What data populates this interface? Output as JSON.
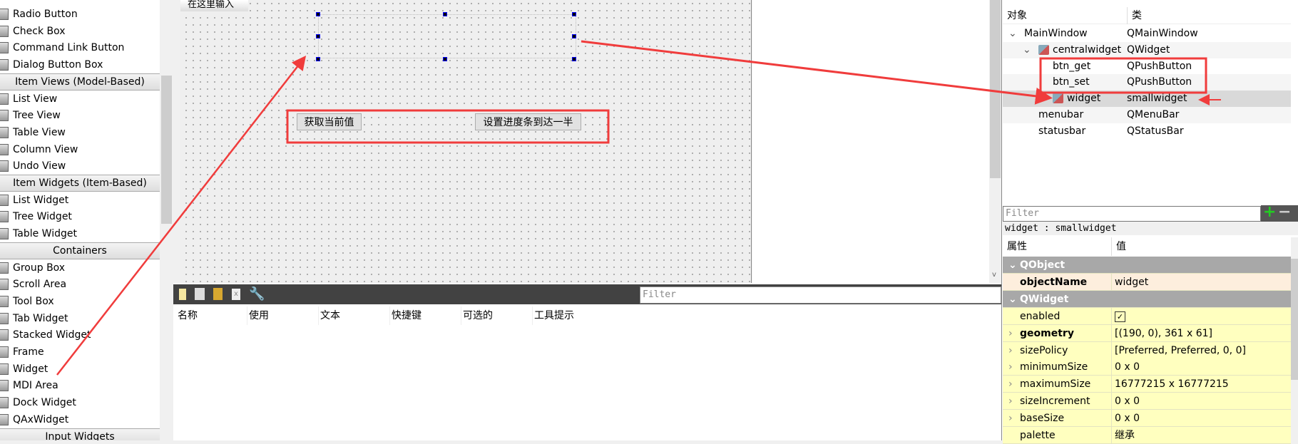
{
  "widget_box": {
    "items": [
      {
        "label": "Radio Button",
        "cat": false
      },
      {
        "label": "Check Box",
        "cat": false
      },
      {
        "label": "Command Link Button",
        "cat": false
      },
      {
        "label": "Dialog Button Box",
        "cat": false
      },
      {
        "label": "Item Views (Model-Based)",
        "cat": true
      },
      {
        "label": "List View",
        "cat": false
      },
      {
        "label": "Tree View",
        "cat": false
      },
      {
        "label": "Table View",
        "cat": false
      },
      {
        "label": "Column View",
        "cat": false
      },
      {
        "label": "Undo View",
        "cat": false
      },
      {
        "label": "Item Widgets (Item-Based)",
        "cat": true
      },
      {
        "label": "List Widget",
        "cat": false
      },
      {
        "label": "Tree Widget",
        "cat": false
      },
      {
        "label": "Table Widget",
        "cat": false
      },
      {
        "label": "Containers",
        "cat": true
      },
      {
        "label": "Group Box",
        "cat": false
      },
      {
        "label": "Scroll Area",
        "cat": false
      },
      {
        "label": "Tool Box",
        "cat": false
      },
      {
        "label": "Tab Widget",
        "cat": false
      },
      {
        "label": "Stacked Widget",
        "cat": false
      },
      {
        "label": "Frame",
        "cat": false
      },
      {
        "label": "Widget",
        "cat": false
      },
      {
        "label": "MDI Area",
        "cat": false
      },
      {
        "label": "Dock Widget",
        "cat": false
      },
      {
        "label": "QAxWidget",
        "cat": false
      },
      {
        "label": "Input Widgets",
        "cat": true
      }
    ]
  },
  "form": {
    "menu_placeholder": "在这里输入",
    "btn_get": "获取当前值",
    "btn_set": "设置进度条到达一半"
  },
  "action_editor": {
    "filter_placeholder": "Filter",
    "columns": [
      "名称",
      "使用",
      "文本",
      "快捷键",
      "可选的",
      "工具提示"
    ]
  },
  "object_inspector": {
    "headers": [
      "对象",
      "类"
    ],
    "rows": [
      {
        "name": "MainWindow",
        "cls": "QMainWindow",
        "indent": 0,
        "expand": true
      },
      {
        "name": "centralwidget",
        "cls": "QWidget",
        "indent": 1,
        "expand": true,
        "icon": true
      },
      {
        "name": "btn_get",
        "cls": "QPushButton",
        "indent": 2
      },
      {
        "name": "btn_set",
        "cls": "QPushButton",
        "indent": 2
      },
      {
        "name": "widget",
        "cls": "smallwidget",
        "indent": 2,
        "icon": true,
        "selected": true
      },
      {
        "name": "menubar",
        "cls": "QMenuBar",
        "indent": 1
      },
      {
        "name": "statusbar",
        "cls": "QStatusBar",
        "indent": 1
      }
    ]
  },
  "property_editor": {
    "filter_placeholder": "Filter",
    "current": "widget : smallwidget",
    "headers": [
      "属性",
      "值"
    ],
    "rows": [
      {
        "group": "QObject"
      },
      {
        "name": "objectName",
        "value": "widget",
        "bold": true,
        "orange": true
      },
      {
        "group": "QWidget"
      },
      {
        "name": "enabled",
        "value": "",
        "checkbox": true
      },
      {
        "name": "geometry",
        "value": "[(190, 0), 361 x 61]",
        "bold": true,
        "expand": true
      },
      {
        "name": "sizePolicy",
        "value": "[Preferred, Preferred, 0, 0]",
        "expand": true
      },
      {
        "name": "minimumSize",
        "value": "0 x 0",
        "expand": true
      },
      {
        "name": "maximumSize",
        "value": "16777215 x 16777215",
        "expand": true
      },
      {
        "name": "sizeIncrement",
        "value": "0 x 0",
        "expand": true
      },
      {
        "name": "baseSize",
        "value": "0 x 0",
        "expand": true
      },
      {
        "name": "palette",
        "value": "继承"
      }
    ]
  },
  "colors": {
    "annotation": "#f03c3c",
    "handle": "#0000ff",
    "group_header": "#a8a8a8",
    "property_bg": "#ffffbf"
  }
}
